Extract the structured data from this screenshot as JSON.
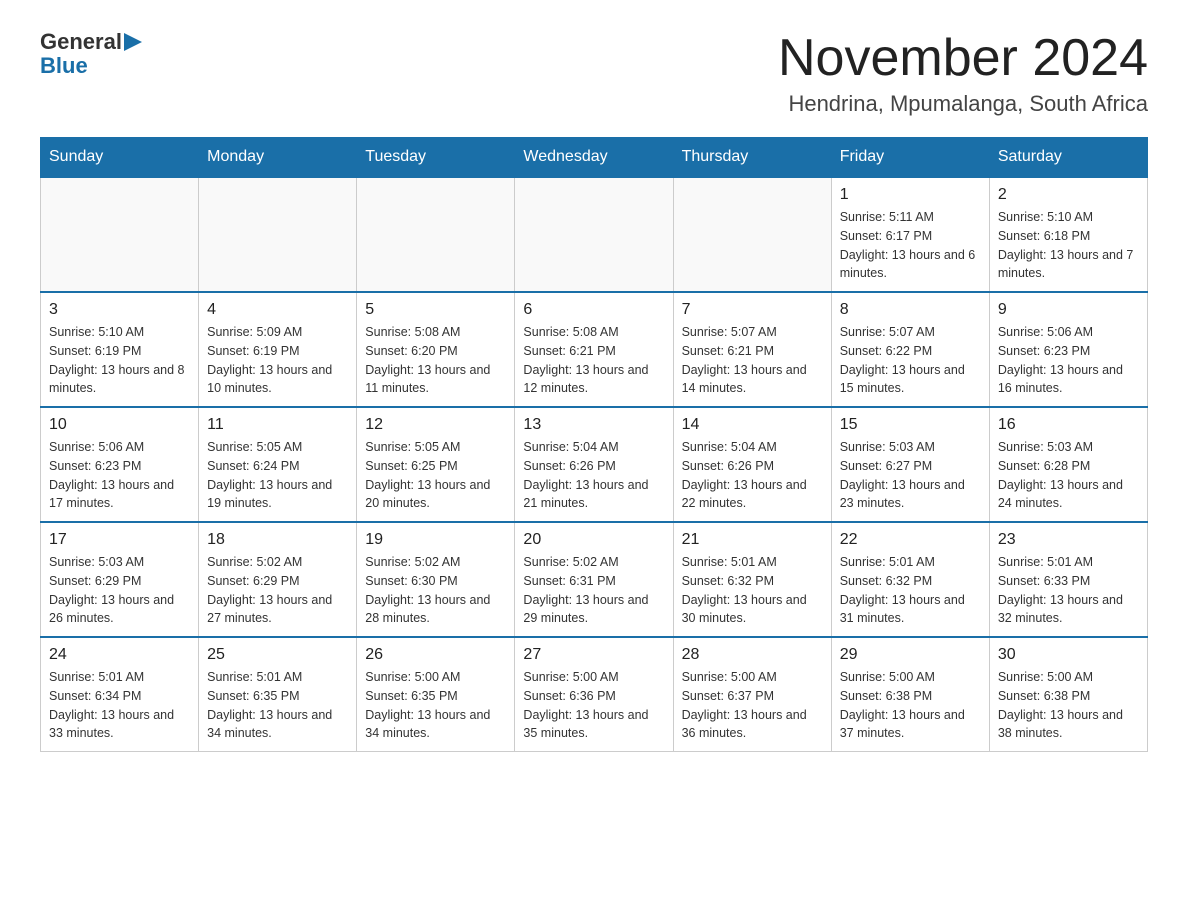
{
  "header": {
    "logo_general": "General",
    "logo_blue": "Blue",
    "title": "November 2024",
    "subtitle": "Hendrina, Mpumalanga, South Africa"
  },
  "calendar": {
    "days_of_week": [
      "Sunday",
      "Monday",
      "Tuesday",
      "Wednesday",
      "Thursday",
      "Friday",
      "Saturday"
    ],
    "weeks": [
      [
        {
          "day": "",
          "info": "",
          "empty": true
        },
        {
          "day": "",
          "info": "",
          "empty": true
        },
        {
          "day": "",
          "info": "",
          "empty": true
        },
        {
          "day": "",
          "info": "",
          "empty": true
        },
        {
          "day": "",
          "info": "",
          "empty": true
        },
        {
          "day": "1",
          "info": "Sunrise: 5:11 AM\nSunset: 6:17 PM\nDaylight: 13 hours and 6 minutes.",
          "empty": false
        },
        {
          "day": "2",
          "info": "Sunrise: 5:10 AM\nSunset: 6:18 PM\nDaylight: 13 hours and 7 minutes.",
          "empty": false
        }
      ],
      [
        {
          "day": "3",
          "info": "Sunrise: 5:10 AM\nSunset: 6:19 PM\nDaylight: 13 hours and 8 minutes.",
          "empty": false
        },
        {
          "day": "4",
          "info": "Sunrise: 5:09 AM\nSunset: 6:19 PM\nDaylight: 13 hours and 10 minutes.",
          "empty": false
        },
        {
          "day": "5",
          "info": "Sunrise: 5:08 AM\nSunset: 6:20 PM\nDaylight: 13 hours and 11 minutes.",
          "empty": false
        },
        {
          "day": "6",
          "info": "Sunrise: 5:08 AM\nSunset: 6:21 PM\nDaylight: 13 hours and 12 minutes.",
          "empty": false
        },
        {
          "day": "7",
          "info": "Sunrise: 5:07 AM\nSunset: 6:21 PM\nDaylight: 13 hours and 14 minutes.",
          "empty": false
        },
        {
          "day": "8",
          "info": "Sunrise: 5:07 AM\nSunset: 6:22 PM\nDaylight: 13 hours and 15 minutes.",
          "empty": false
        },
        {
          "day": "9",
          "info": "Sunrise: 5:06 AM\nSunset: 6:23 PM\nDaylight: 13 hours and 16 minutes.",
          "empty": false
        }
      ],
      [
        {
          "day": "10",
          "info": "Sunrise: 5:06 AM\nSunset: 6:23 PM\nDaylight: 13 hours and 17 minutes.",
          "empty": false
        },
        {
          "day": "11",
          "info": "Sunrise: 5:05 AM\nSunset: 6:24 PM\nDaylight: 13 hours and 19 minutes.",
          "empty": false
        },
        {
          "day": "12",
          "info": "Sunrise: 5:05 AM\nSunset: 6:25 PM\nDaylight: 13 hours and 20 minutes.",
          "empty": false
        },
        {
          "day": "13",
          "info": "Sunrise: 5:04 AM\nSunset: 6:26 PM\nDaylight: 13 hours and 21 minutes.",
          "empty": false
        },
        {
          "day": "14",
          "info": "Sunrise: 5:04 AM\nSunset: 6:26 PM\nDaylight: 13 hours and 22 minutes.",
          "empty": false
        },
        {
          "day": "15",
          "info": "Sunrise: 5:03 AM\nSunset: 6:27 PM\nDaylight: 13 hours and 23 minutes.",
          "empty": false
        },
        {
          "day": "16",
          "info": "Sunrise: 5:03 AM\nSunset: 6:28 PM\nDaylight: 13 hours and 24 minutes.",
          "empty": false
        }
      ],
      [
        {
          "day": "17",
          "info": "Sunrise: 5:03 AM\nSunset: 6:29 PM\nDaylight: 13 hours and 26 minutes.",
          "empty": false
        },
        {
          "day": "18",
          "info": "Sunrise: 5:02 AM\nSunset: 6:29 PM\nDaylight: 13 hours and 27 minutes.",
          "empty": false
        },
        {
          "day": "19",
          "info": "Sunrise: 5:02 AM\nSunset: 6:30 PM\nDaylight: 13 hours and 28 minutes.",
          "empty": false
        },
        {
          "day": "20",
          "info": "Sunrise: 5:02 AM\nSunset: 6:31 PM\nDaylight: 13 hours and 29 minutes.",
          "empty": false
        },
        {
          "day": "21",
          "info": "Sunrise: 5:01 AM\nSunset: 6:32 PM\nDaylight: 13 hours and 30 minutes.",
          "empty": false
        },
        {
          "day": "22",
          "info": "Sunrise: 5:01 AM\nSunset: 6:32 PM\nDaylight: 13 hours and 31 minutes.",
          "empty": false
        },
        {
          "day": "23",
          "info": "Sunrise: 5:01 AM\nSunset: 6:33 PM\nDaylight: 13 hours and 32 minutes.",
          "empty": false
        }
      ],
      [
        {
          "day": "24",
          "info": "Sunrise: 5:01 AM\nSunset: 6:34 PM\nDaylight: 13 hours and 33 minutes.",
          "empty": false
        },
        {
          "day": "25",
          "info": "Sunrise: 5:01 AM\nSunset: 6:35 PM\nDaylight: 13 hours and 34 minutes.",
          "empty": false
        },
        {
          "day": "26",
          "info": "Sunrise: 5:00 AM\nSunset: 6:35 PM\nDaylight: 13 hours and 34 minutes.",
          "empty": false
        },
        {
          "day": "27",
          "info": "Sunrise: 5:00 AM\nSunset: 6:36 PM\nDaylight: 13 hours and 35 minutes.",
          "empty": false
        },
        {
          "day": "28",
          "info": "Sunrise: 5:00 AM\nSunset: 6:37 PM\nDaylight: 13 hours and 36 minutes.",
          "empty": false
        },
        {
          "day": "29",
          "info": "Sunrise: 5:00 AM\nSunset: 6:38 PM\nDaylight: 13 hours and 37 minutes.",
          "empty": false
        },
        {
          "day": "30",
          "info": "Sunrise: 5:00 AM\nSunset: 6:38 PM\nDaylight: 13 hours and 38 minutes.",
          "empty": false
        }
      ]
    ]
  }
}
